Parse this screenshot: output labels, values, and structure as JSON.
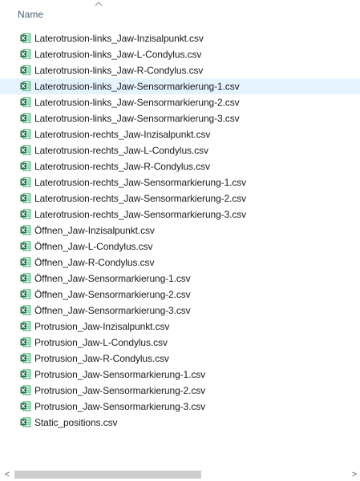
{
  "header": {
    "column_name": "Name",
    "sort_direction": "ascending"
  },
  "colors": {
    "selected_row": "#e5f3ff",
    "excel_green": "#1f7244",
    "header_text": "#4c607a"
  },
  "files": [
    {
      "name": "Laterotrusion-links_Jaw-Inzisalpunkt.csv",
      "icon": "excel-csv-icon",
      "selected": false
    },
    {
      "name": "Laterotrusion-links_Jaw-L-Condylus.csv",
      "icon": "excel-csv-icon",
      "selected": false
    },
    {
      "name": "Laterotrusion-links_Jaw-R-Condylus.csv",
      "icon": "excel-csv-icon",
      "selected": false
    },
    {
      "name": "Laterotrusion-links_Jaw-Sensormarkierung-1.csv",
      "icon": "excel-csv-icon",
      "selected": true
    },
    {
      "name": "Laterotrusion-links_Jaw-Sensormarkierung-2.csv",
      "icon": "excel-csv-icon",
      "selected": false
    },
    {
      "name": "Laterotrusion-links_Jaw-Sensormarkierung-3.csv",
      "icon": "excel-csv-icon",
      "selected": false
    },
    {
      "name": "Laterotrusion-rechts_Jaw-Inzisalpunkt.csv",
      "icon": "excel-csv-icon",
      "selected": false
    },
    {
      "name": "Laterotrusion-rechts_Jaw-L-Condylus.csv",
      "icon": "excel-csv-icon",
      "selected": false
    },
    {
      "name": "Laterotrusion-rechts_Jaw-R-Condylus.csv",
      "icon": "excel-csv-icon",
      "selected": false
    },
    {
      "name": "Laterotrusion-rechts_Jaw-Sensormarkierung-1.csv",
      "icon": "excel-csv-icon",
      "selected": false
    },
    {
      "name": "Laterotrusion-rechts_Jaw-Sensormarkierung-2.csv",
      "icon": "excel-csv-icon",
      "selected": false
    },
    {
      "name": "Laterotrusion-rechts_Jaw-Sensormarkierung-3.csv",
      "icon": "excel-csv-icon",
      "selected": false
    },
    {
      "name": "Öffnen_Jaw-Inzisalpunkt.csv",
      "icon": "excel-csv-icon",
      "selected": false
    },
    {
      "name": "Öffnen_Jaw-L-Condylus.csv",
      "icon": "excel-csv-icon",
      "selected": false
    },
    {
      "name": "Öffnen_Jaw-R-Condylus.csv",
      "icon": "excel-csv-icon",
      "selected": false
    },
    {
      "name": "Öffnen_Jaw-Sensormarkierung-1.csv",
      "icon": "excel-csv-icon",
      "selected": false
    },
    {
      "name": "Öffnen_Jaw-Sensormarkierung-2.csv",
      "icon": "excel-csv-icon",
      "selected": false
    },
    {
      "name": "Öffnen_Jaw-Sensormarkierung-3.csv",
      "icon": "excel-csv-icon",
      "selected": false
    },
    {
      "name": "Protrusion_Jaw-Inzisalpunkt.csv",
      "icon": "excel-csv-icon",
      "selected": false
    },
    {
      "name": "Protrusion_Jaw-L-Condylus.csv",
      "icon": "excel-csv-icon",
      "selected": false
    },
    {
      "name": "Protrusion_Jaw-R-Condylus.csv",
      "icon": "excel-csv-icon",
      "selected": false
    },
    {
      "name": "Protrusion_Jaw-Sensormarkierung-1.csv",
      "icon": "excel-csv-icon",
      "selected": false
    },
    {
      "name": "Protrusion_Jaw-Sensormarkierung-2.csv",
      "icon": "excel-csv-icon",
      "selected": false
    },
    {
      "name": "Protrusion_Jaw-Sensormarkierung-3.csv",
      "icon": "excel-csv-icon",
      "selected": false
    },
    {
      "name": "Static_positions.csv",
      "icon": "excel-csv-icon",
      "selected": false
    }
  ],
  "scrollbar": {
    "left_arrow": "<",
    "right_arrow": ">"
  }
}
